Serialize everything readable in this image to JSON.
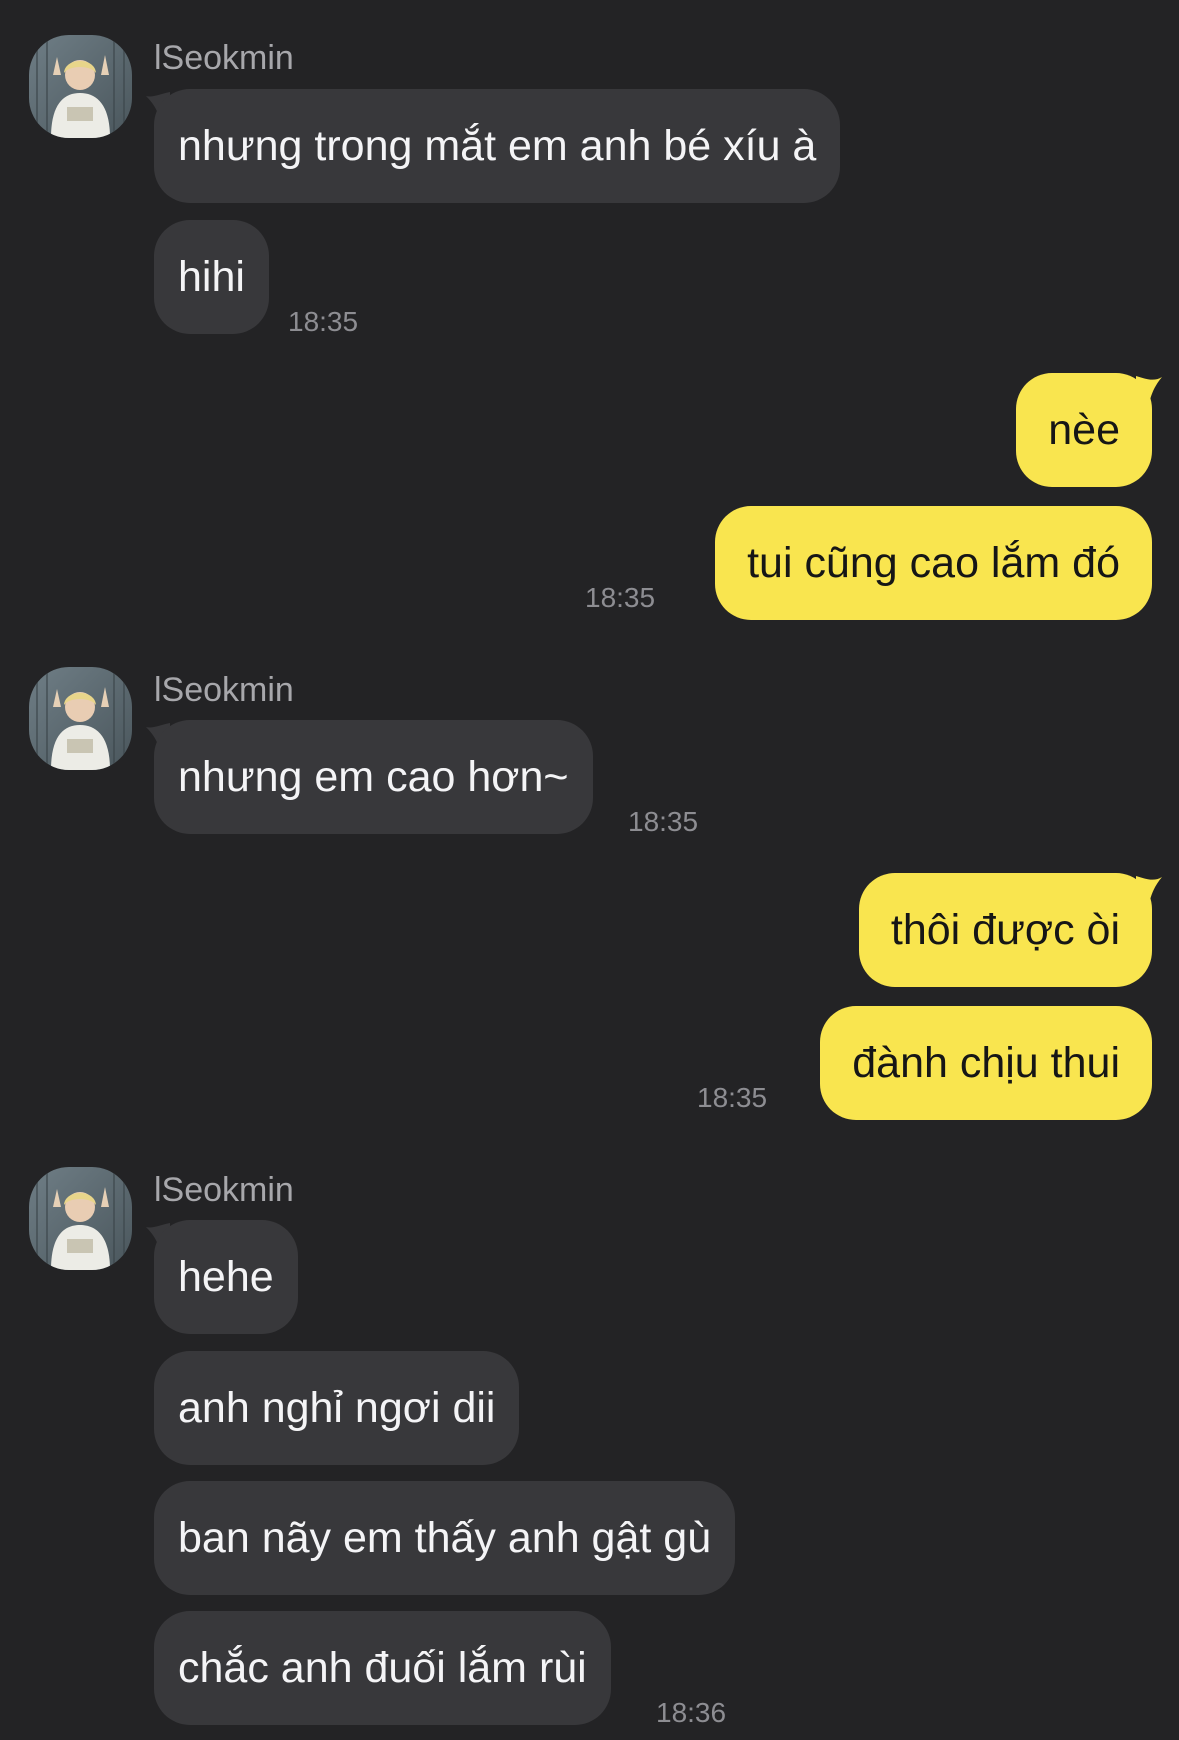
{
  "contact": {
    "name": "lSeokmin",
    "avatar_icon": "avatar-photo"
  },
  "colors": {
    "background": "#232325",
    "incoming_bubble": "#38383b",
    "outgoing_bubble": "#f9e54f",
    "timestamp": "#8d8d92"
  },
  "groups": [
    {
      "sender": "lSeokmin",
      "messages": [
        "nhưng trong mắt em anh bé xíu à",
        "hihi"
      ],
      "time": "18:35"
    },
    {
      "sender": "me",
      "messages": [
        "nèe",
        "tui cũng cao lắm đó"
      ],
      "time": "18:35"
    },
    {
      "sender": "lSeokmin",
      "messages": [
        "nhưng em cao hơn~"
      ],
      "time": "18:35"
    },
    {
      "sender": "me",
      "messages": [
        "thôi được òi",
        "đành chịu thui"
      ],
      "time": "18:35"
    },
    {
      "sender": "lSeokmin",
      "messages": [
        "hehe",
        "anh nghỉ ngơi dii",
        "ban nãy em thấy anh gật gù",
        "chắc anh đuối lắm rùi"
      ],
      "time": "18:36"
    }
  ]
}
